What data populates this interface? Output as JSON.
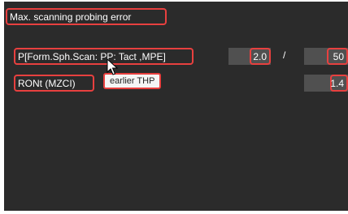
{
  "panel": {
    "title": "Max. scanning probing error"
  },
  "rows": [
    {
      "label": "P[Form.Sph.Scan: PP: Tact ,MPE]",
      "value": "2.0",
      "separator": "/",
      "limit": "50"
    },
    {
      "label": "RONt (MZCI)",
      "value": "1.4"
    }
  ],
  "tooltip": {
    "text": "earlier THP"
  },
  "colors": {
    "panel_bg": "#2b2b2b",
    "cell_bg": "#505050",
    "highlight": "#e8403f",
    "text": "#ffffff"
  },
  "icons": {
    "cursor": "mouse-pointer-icon"
  }
}
